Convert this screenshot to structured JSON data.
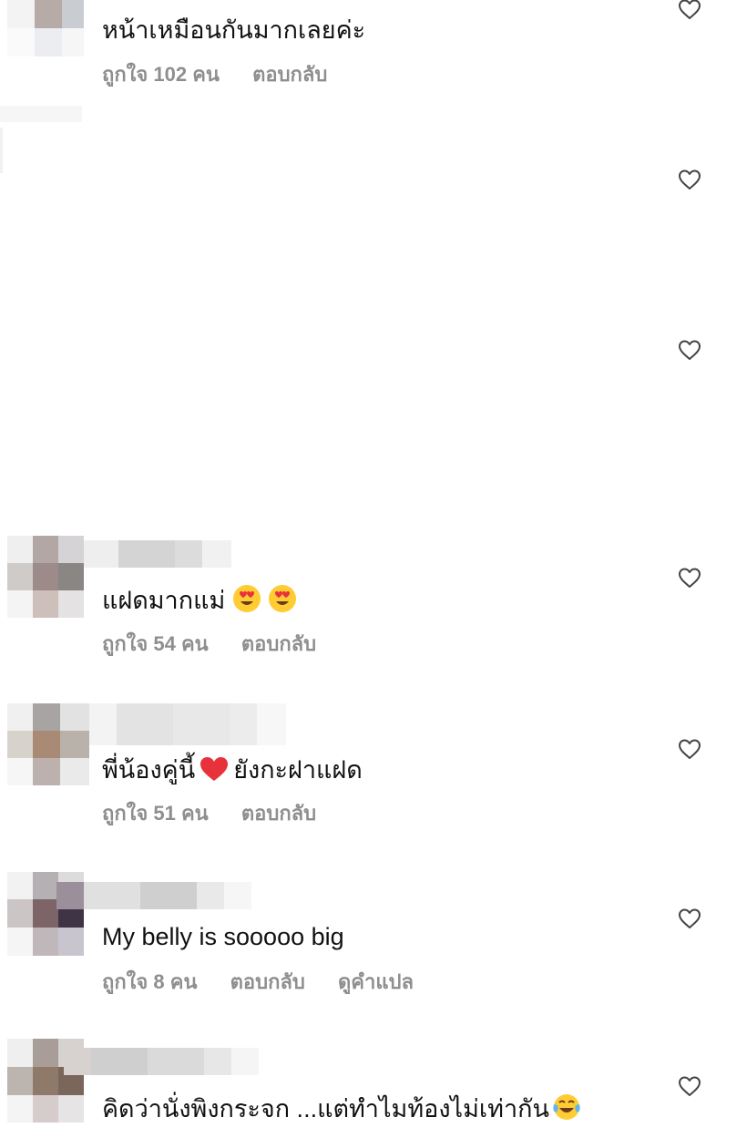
{
  "comments": [
    {
      "text": "หน้าเหมือนกันมากเลยค่ะ",
      "likes_label": "ถูกใจ 102 คน",
      "reply_label": "ตอบกลับ"
    },
    {
      "text": "แฝดมากแม่",
      "likes_label": "ถูกใจ 54 คน",
      "reply_label": "ตอบกลับ",
      "emoji": [
        "heart-eyes",
        "heart-eyes"
      ]
    },
    {
      "text_before": "พี่น้องคู่นี้",
      "text_after": "ยังกะฝาแฝด",
      "likes_label": "ถูกใจ 51 คน",
      "reply_label": "ตอบกลับ",
      "emoji": [
        "red-heart"
      ]
    },
    {
      "text": "My belly is sooooo big",
      "likes_label": "ถูกใจ 8 คน",
      "reply_label": "ตอบกลับ",
      "translate_label": "ดูคำแปล"
    },
    {
      "text": "คิดว่านั่งพิงกระจก ...แต่ทำไมท้องไม่เท่ากัน",
      "emoji": [
        "tears-of-joy"
      ]
    }
  ],
  "icons": {
    "like": "heart-outline-icon"
  },
  "colors": {
    "meta_text": "#8e8e8e",
    "text": "#111111",
    "emoji_red": "#e8323b",
    "emoji_yellow": "#ffcc33"
  }
}
